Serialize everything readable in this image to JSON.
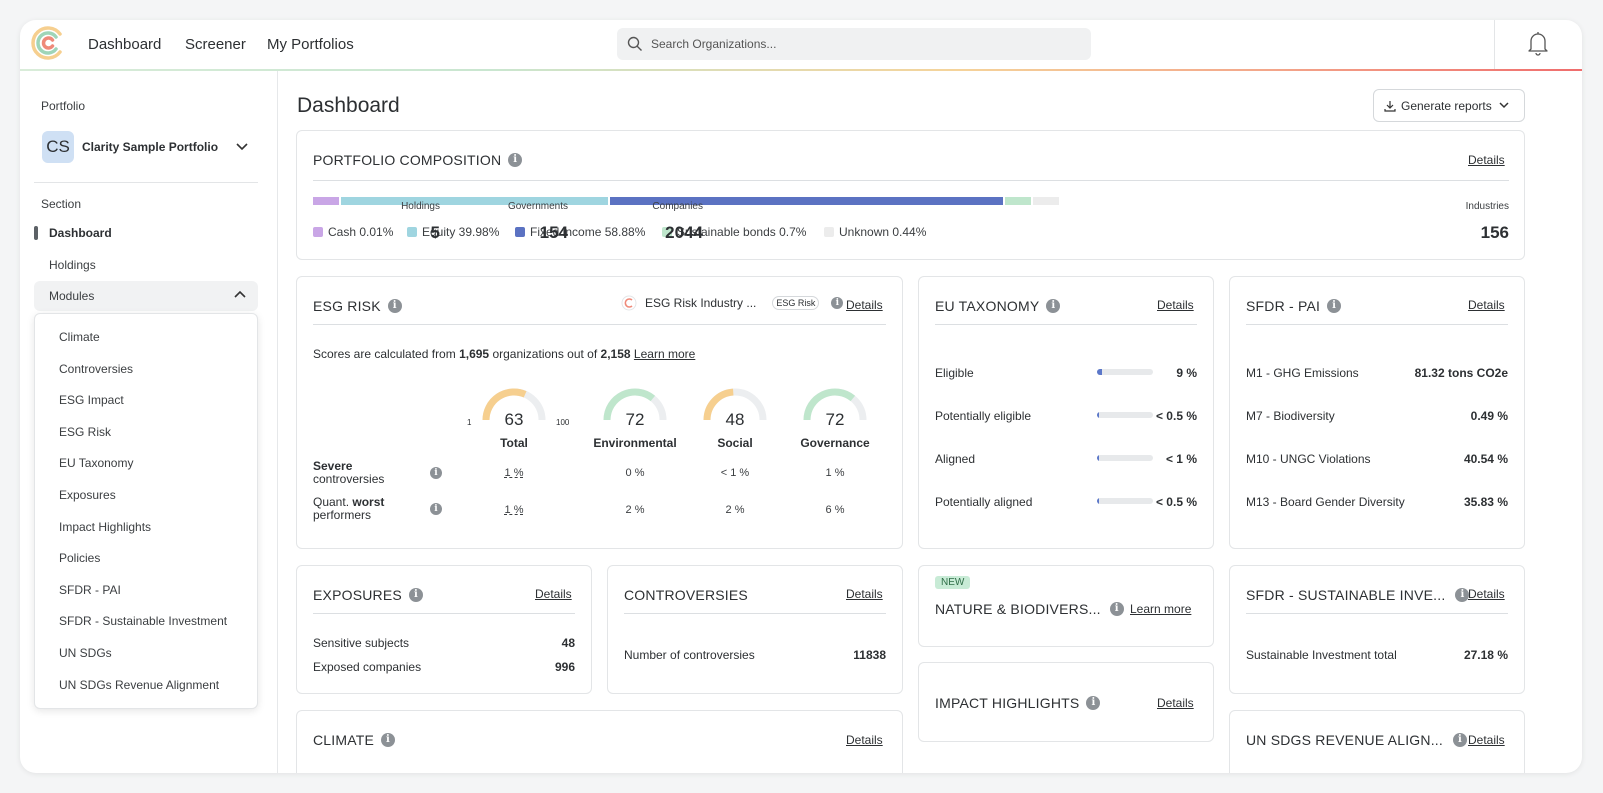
{
  "nav": {
    "links": [
      "Dashboard",
      "Screener",
      "My Portfolios"
    ],
    "search_placeholder": "Search Organizations..."
  },
  "sidebar": {
    "portfolio_label": "Portfolio",
    "portfolio_initials": "CS",
    "portfolio_name": "Clarity Sample Portfolio",
    "section_label": "Section",
    "items": [
      "Dashboard",
      "Holdings"
    ],
    "modules_label": "Modules",
    "module_items": [
      "Climate",
      "Controversies",
      "ESG Impact",
      "ESG Risk",
      "EU Taxonomy",
      "Exposures",
      "Impact Highlights",
      "Policies",
      "SFDR - PAI",
      "SFDR - Sustainable Investment",
      "UN SDGs",
      "UN SDGs Revenue Alignment"
    ]
  },
  "main": {
    "title": "Dashboard",
    "generate_reports": "Generate reports",
    "details": "Details"
  },
  "composition": {
    "title": "PORTFOLIO COMPOSITION",
    "segments": [
      {
        "label": "Cash 0.01%",
        "color": "#c9a6e6",
        "share": 0.01
      },
      {
        "label": "Equity 39.98%",
        "color": "#9fd5e0",
        "share": 39.98
      },
      {
        "label": "Fixed income 58.88%",
        "color": "#5b72c2",
        "share": 58.88
      },
      {
        "label": "Sustainable bonds 0.7%",
        "color": "#bfe6cc",
        "share": 0.7
      },
      {
        "label": "Unknown 0.44%",
        "color": "#ececec",
        "share": 0.44
      }
    ],
    "stats": [
      {
        "label": "Holdings",
        "value": "5"
      },
      {
        "label": "Governments",
        "value": "154"
      },
      {
        "label": "Companies",
        "value": "2044"
      },
      {
        "label": "Industries",
        "value": "156"
      }
    ]
  },
  "esg_risk": {
    "title": "ESG RISK",
    "source_label": "ESG Risk Industry ...",
    "source_tag": "ESG Risk",
    "note_prefix": "Scores are calculated from",
    "note_count": "1,695",
    "note_mid": "organizations out of",
    "note_total": "2,158",
    "learn_more": "Learn more",
    "scale_min": "1",
    "scale_max": "100",
    "gauges": [
      {
        "label": "Total",
        "value": "63",
        "color": "#f6cf8f",
        "level": 63
      },
      {
        "label": "Environmental",
        "value": "72",
        "color": "#bfe6cc",
        "level": 72
      },
      {
        "label": "Social",
        "value": "48",
        "color": "#f6cf8f",
        "level": 48
      },
      {
        "label": "Governance",
        "value": "72",
        "color": "#bfe6cc",
        "level": 72
      }
    ],
    "rows": [
      {
        "label_a": "Severe",
        "label_b": "controversies",
        "values": [
          "1 %",
          "0 %",
          "< 1 %",
          "1 %"
        ]
      },
      {
        "label_a": "Quant.",
        "label_bold": "worst",
        "label_b": "performers",
        "values": [
          "1 %",
          "2 %",
          "2 %",
          "6 %"
        ]
      }
    ]
  },
  "eu_taxonomy": {
    "title": "EU TAXONOMY",
    "rows": [
      {
        "label": "Eligible",
        "value": "9 %",
        "level": 0.09
      },
      {
        "label": "Potentially eligible",
        "value": "< 0.5 %",
        "level": 0.005
      },
      {
        "label": "Aligned",
        "value": "< 1 %",
        "level": 0.01
      },
      {
        "label": "Potentially aligned",
        "value": "< 0.5 %",
        "level": 0.005
      }
    ]
  },
  "sfdr_pai": {
    "title": "SFDR - PAI",
    "rows": [
      {
        "label": "M1 - GHG Emissions",
        "value": "81.32 tons CO2e"
      },
      {
        "label": "M7 - Biodiversity",
        "value": "0.49 %"
      },
      {
        "label": "M10 - UNGC Violations",
        "value": "40.54 %"
      },
      {
        "label": "M13 - Board Gender Diversity",
        "value": "35.83 %"
      }
    ]
  },
  "exposures": {
    "title": "EXPOSURES",
    "rows": [
      {
        "label": "Sensitive subjects",
        "value": "48"
      },
      {
        "label": "Exposed companies",
        "value": "996"
      }
    ]
  },
  "controversies": {
    "title": "CONTROVERSIES",
    "row": {
      "label": "Number of controversies",
      "value": "11838"
    }
  },
  "nature": {
    "badge": "NEW",
    "title": "NATURE & BIODIVERS...",
    "link": "Learn more"
  },
  "impact": {
    "title": "IMPACT HIGHLIGHTS"
  },
  "sfdr_si": {
    "title": "SFDR - SUSTAINABLE INVE...",
    "row": {
      "label": "Sustainable Investment total",
      "value": "27.18 %"
    }
  },
  "climate": {
    "title": "CLIMATE"
  },
  "un_sdgs_rev": {
    "title": "UN SDGS REVENUE ALIGN..."
  }
}
